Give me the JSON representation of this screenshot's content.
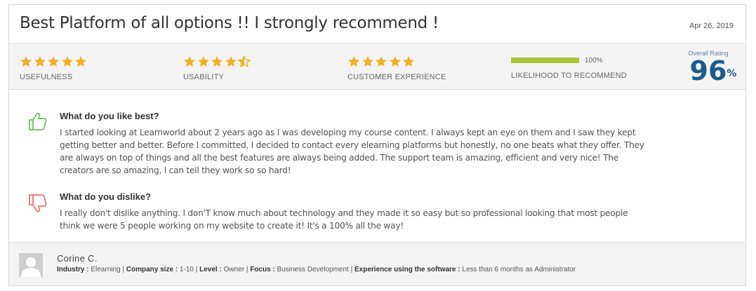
{
  "review": {
    "title": "Best Platform of all options !! I strongly recommend !",
    "date": "Apr 26, 2019"
  },
  "ratings": [
    {
      "label": "USEFULNESS",
      "stars": 5
    },
    {
      "label": "USABILITY",
      "stars": 4.5
    },
    {
      "label": "CUSTOMER EXPERIENCE",
      "stars": 5
    }
  ],
  "likelihood": {
    "label": "LIKELIHOOD TO RECOMMEND",
    "percent_text": "100%",
    "value": 1.0
  },
  "overall": {
    "label": "Overall Rating",
    "value": "96",
    "unit": "%"
  },
  "likes": {
    "heading": "What do you like best?",
    "text": "I started looking at Learnworld about 2 years ago as I was developing my course content. I always kept an eye on them and I saw they kept getting better and better. Before I committed, I decided to contact every elearning platforms but honestly, no one beats what they offer. They are always on top of things and all the best features are always being added. The support team is amazing, efficient and very nice! The creators are so amazing, I can tell they work so so hard!"
  },
  "dislikes": {
    "heading": "What do you dislike?",
    "text": "I really don't dislike anything. I don'T know much about technology and they made it so easy but so professional looking that most people think we were 5 people working on my website to create it! It's a 100% all the way!"
  },
  "reviewer": {
    "name": "Corine C.",
    "industry_label": "Industry :",
    "industry": "Elearning",
    "company_size_label": "Company size :",
    "company_size": "1-10",
    "level_label": "Level :",
    "level": "Owner",
    "focus_label": "Focus :",
    "focus": "Business Development",
    "experience_label": "Experience using the software :",
    "experience": "Less than 6 months as Administrator",
    "separator": "|"
  },
  "colors": {
    "star": "#f2b01e",
    "likelihood_fill": "#a7c53a",
    "overall": "#1a5c8f",
    "thumbs_up": "#7cc576",
    "thumbs_down": "#e8837c"
  },
  "icons": {
    "like": "thumbs-up-icon",
    "dislike": "thumbs-down-icon",
    "star": "star-icon",
    "avatar": "user-silhouette-icon"
  }
}
